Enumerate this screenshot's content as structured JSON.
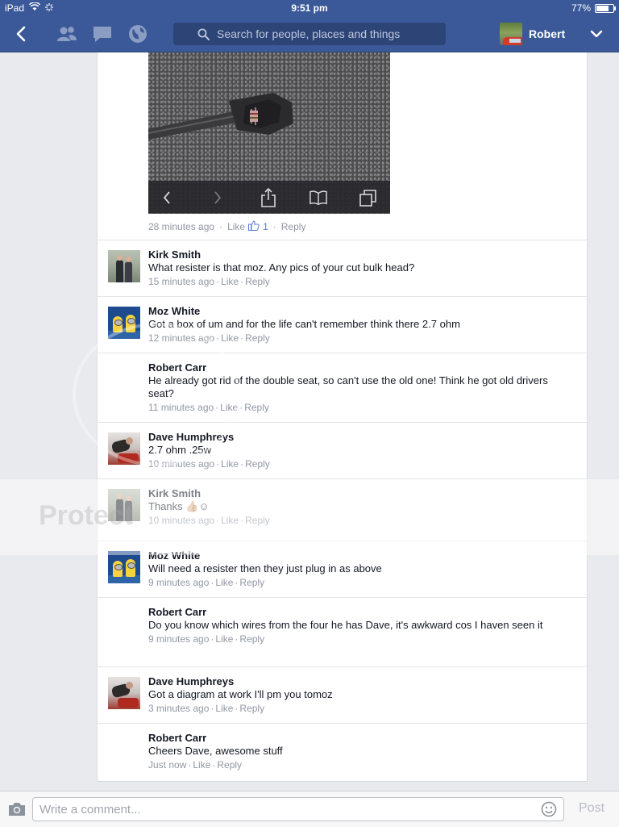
{
  "status_bar": {
    "device": "iPad",
    "time": "9:51 pm",
    "battery": "77%",
    "battery_level": 0.77
  },
  "nav": {
    "back_icon": "chevron-left-icon",
    "friends_icon": "friends-icon",
    "messages_icon": "messages-icon",
    "globe_icon": "globe-icon",
    "search_placeholder": "Search for people, places and things",
    "profile_name": "Robert",
    "menu_icon": "chevron-down-icon"
  },
  "photo_post": {
    "time": "28 minutes ago",
    "like": "Like",
    "like_count": "1",
    "reply": "Reply"
  },
  "comments": [
    {
      "name": "Kirk Smith",
      "text": "What resister is that moz. Any pics of your cut bulk head?",
      "time": "15 minutes ago",
      "like": "Like",
      "reply": "Reply",
      "avatar": "kirk"
    },
    {
      "name": "Moz White",
      "text": "Got a box of um and for the life can't remember think there 2.7 ohm",
      "time": "12 minutes ago",
      "like": "Like",
      "reply": "Reply",
      "avatar": "moz"
    },
    {
      "name": "Robert Carr",
      "text": "He already got rid of the double seat, so can't use the old one! Think he got old drivers seat?",
      "time": "11 minutes ago",
      "like": "Like",
      "reply": "Reply",
      "avatar": "robert"
    },
    {
      "name": "Dave Humphreys",
      "text": "2.7 ohm .25w",
      "time": "10 minutes ago",
      "like": "Like",
      "reply": "Reply",
      "avatar": "dave"
    },
    {
      "name": "Kirk Smith",
      "text": "Thanks 👍🏼☺",
      "time": "10 minutes ago",
      "like": "Like",
      "reply": "Reply",
      "avatar": "kirk"
    },
    {
      "name": "Moz White",
      "text": "Will need a resister then they just plug in as above",
      "time": "9 minutes ago",
      "like": "Like",
      "reply": "Reply",
      "avatar": "moz"
    },
    {
      "name": "Robert Carr",
      "text": "Do you know which wires from the four he has Dave, it's awkward cos I haven seen it",
      "time": "9 minutes ago",
      "like": "Like",
      "reply": "Reply",
      "avatar": "robert"
    },
    {
      "name": "Dave Humphreys",
      "text": "Got a diagram at work I'll pm you tomoz",
      "time": "3 minutes ago",
      "like": "Like",
      "reply": "Reply",
      "avatar": "dave"
    },
    {
      "name": "Robert Carr",
      "text": "Cheers Dave, awesome stuff",
      "time": "Just now",
      "like": "Like",
      "reply": "Reply",
      "avatar": "robert"
    }
  ],
  "composer": {
    "placeholder": "Write a comment...",
    "post_label": "Post",
    "camera_icon": "camera-icon",
    "emoji_icon": "smiley-icon"
  },
  "watermark": "Protect"
}
